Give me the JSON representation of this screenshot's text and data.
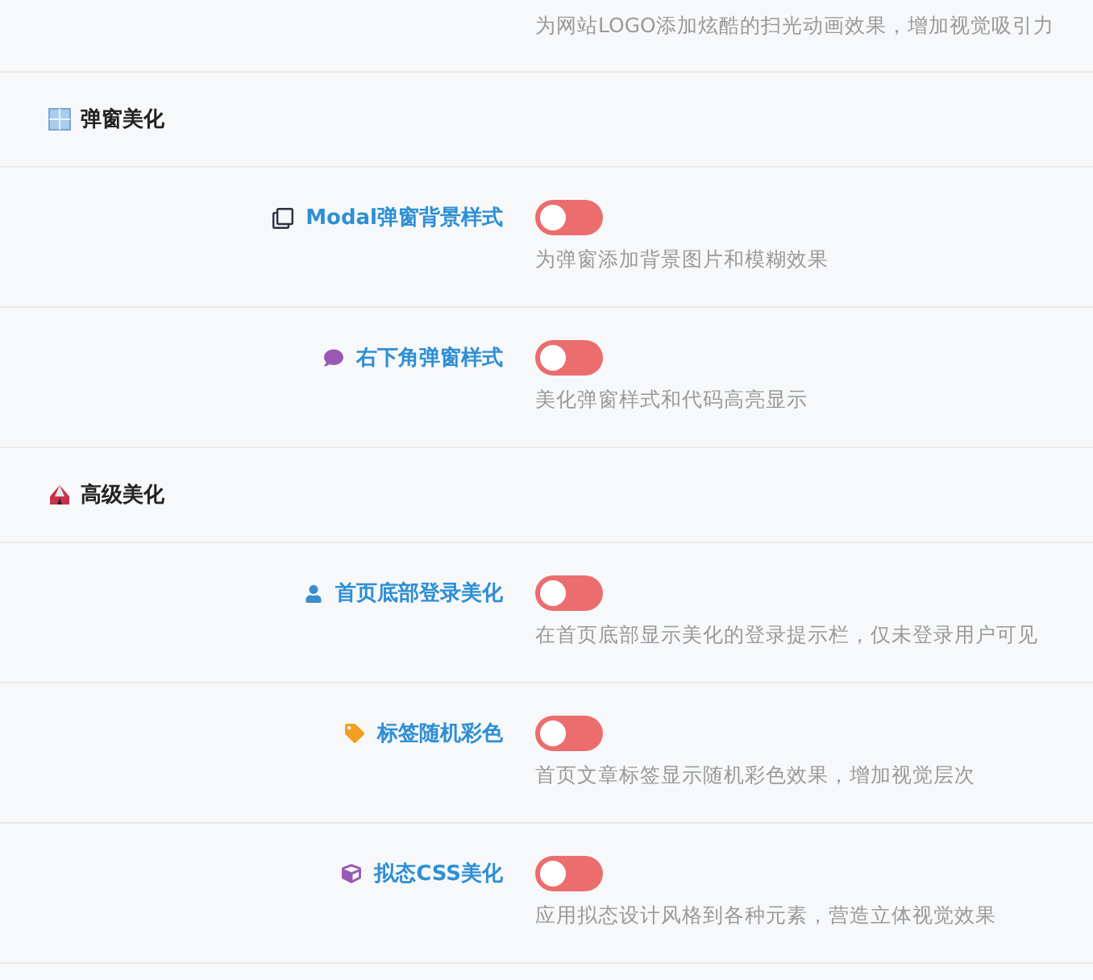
{
  "top_item": {
    "description": "为网站LOGO添加炫酷的扫光动画效果，增加视觉吸引力"
  },
  "sections": [
    {
      "title": "弹窗美化",
      "kind": "window",
      "items": [
        {
          "label": "Modal弹窗背景样式",
          "kind": "clone",
          "on": false,
          "description": "为弹窗添加背景图片和模糊效果"
        },
        {
          "label": "右下角弹窗样式",
          "kind": "comment",
          "on": false,
          "description": "美化弹窗样式和代码高亮显示"
        }
      ]
    },
    {
      "title": "高级美化",
      "kind": "tent",
      "items": [
        {
          "label": "首页底部登录美化",
          "kind": "user",
          "on": false,
          "description": "在首页底部显示美化的登录提示栏，仅未登录用户可见"
        },
        {
          "label": "标签随机彩色",
          "kind": "tag",
          "on": false,
          "description": "首页文章标签显示随机彩色效果，增加视觉层次"
        },
        {
          "label": "拟态CSS美化",
          "kind": "cube",
          "on": false,
          "description": "应用拟态设计风格到各种元素，营造立体视觉效果"
        }
      ]
    }
  ]
}
